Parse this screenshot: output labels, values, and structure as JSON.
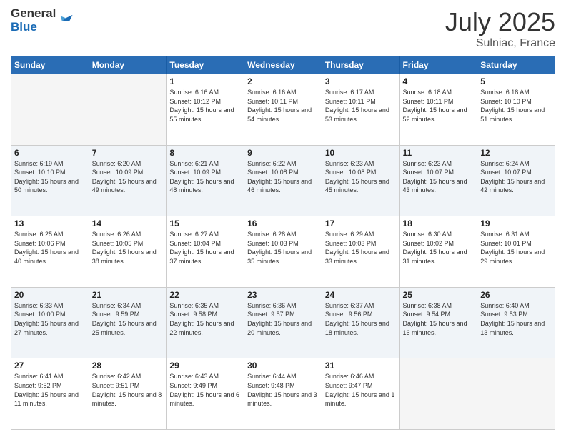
{
  "logo": {
    "general": "General",
    "blue": "Blue"
  },
  "title": {
    "month": "July 2025",
    "location": "Sulniac, France"
  },
  "weekdays": [
    "Sunday",
    "Monday",
    "Tuesday",
    "Wednesday",
    "Thursday",
    "Friday",
    "Saturday"
  ],
  "weeks": [
    [
      {
        "day": "",
        "sunrise": "",
        "sunset": "",
        "daylight": ""
      },
      {
        "day": "",
        "sunrise": "",
        "sunset": "",
        "daylight": ""
      },
      {
        "day": "1",
        "sunrise": "Sunrise: 6:16 AM",
        "sunset": "Sunset: 10:12 PM",
        "daylight": "Daylight: 15 hours and 55 minutes."
      },
      {
        "day": "2",
        "sunrise": "Sunrise: 6:16 AM",
        "sunset": "Sunset: 10:11 PM",
        "daylight": "Daylight: 15 hours and 54 minutes."
      },
      {
        "day": "3",
        "sunrise": "Sunrise: 6:17 AM",
        "sunset": "Sunset: 10:11 PM",
        "daylight": "Daylight: 15 hours and 53 minutes."
      },
      {
        "day": "4",
        "sunrise": "Sunrise: 6:18 AM",
        "sunset": "Sunset: 10:11 PM",
        "daylight": "Daylight: 15 hours and 52 minutes."
      },
      {
        "day": "5",
        "sunrise": "Sunrise: 6:18 AM",
        "sunset": "Sunset: 10:10 PM",
        "daylight": "Daylight: 15 hours and 51 minutes."
      }
    ],
    [
      {
        "day": "6",
        "sunrise": "Sunrise: 6:19 AM",
        "sunset": "Sunset: 10:10 PM",
        "daylight": "Daylight: 15 hours and 50 minutes."
      },
      {
        "day": "7",
        "sunrise": "Sunrise: 6:20 AM",
        "sunset": "Sunset: 10:09 PM",
        "daylight": "Daylight: 15 hours and 49 minutes."
      },
      {
        "day": "8",
        "sunrise": "Sunrise: 6:21 AM",
        "sunset": "Sunset: 10:09 PM",
        "daylight": "Daylight: 15 hours and 48 minutes."
      },
      {
        "day": "9",
        "sunrise": "Sunrise: 6:22 AM",
        "sunset": "Sunset: 10:08 PM",
        "daylight": "Daylight: 15 hours and 46 minutes."
      },
      {
        "day": "10",
        "sunrise": "Sunrise: 6:23 AM",
        "sunset": "Sunset: 10:08 PM",
        "daylight": "Daylight: 15 hours and 45 minutes."
      },
      {
        "day": "11",
        "sunrise": "Sunrise: 6:23 AM",
        "sunset": "Sunset: 10:07 PM",
        "daylight": "Daylight: 15 hours and 43 minutes."
      },
      {
        "day": "12",
        "sunrise": "Sunrise: 6:24 AM",
        "sunset": "Sunset: 10:07 PM",
        "daylight": "Daylight: 15 hours and 42 minutes."
      }
    ],
    [
      {
        "day": "13",
        "sunrise": "Sunrise: 6:25 AM",
        "sunset": "Sunset: 10:06 PM",
        "daylight": "Daylight: 15 hours and 40 minutes."
      },
      {
        "day": "14",
        "sunrise": "Sunrise: 6:26 AM",
        "sunset": "Sunset: 10:05 PM",
        "daylight": "Daylight: 15 hours and 38 minutes."
      },
      {
        "day": "15",
        "sunrise": "Sunrise: 6:27 AM",
        "sunset": "Sunset: 10:04 PM",
        "daylight": "Daylight: 15 hours and 37 minutes."
      },
      {
        "day": "16",
        "sunrise": "Sunrise: 6:28 AM",
        "sunset": "Sunset: 10:03 PM",
        "daylight": "Daylight: 15 hours and 35 minutes."
      },
      {
        "day": "17",
        "sunrise": "Sunrise: 6:29 AM",
        "sunset": "Sunset: 10:03 PM",
        "daylight": "Daylight: 15 hours and 33 minutes."
      },
      {
        "day": "18",
        "sunrise": "Sunrise: 6:30 AM",
        "sunset": "Sunset: 10:02 PM",
        "daylight": "Daylight: 15 hours and 31 minutes."
      },
      {
        "day": "19",
        "sunrise": "Sunrise: 6:31 AM",
        "sunset": "Sunset: 10:01 PM",
        "daylight": "Daylight: 15 hours and 29 minutes."
      }
    ],
    [
      {
        "day": "20",
        "sunrise": "Sunrise: 6:33 AM",
        "sunset": "Sunset: 10:00 PM",
        "daylight": "Daylight: 15 hours and 27 minutes."
      },
      {
        "day": "21",
        "sunrise": "Sunrise: 6:34 AM",
        "sunset": "Sunset: 9:59 PM",
        "daylight": "Daylight: 15 hours and 25 minutes."
      },
      {
        "day": "22",
        "sunrise": "Sunrise: 6:35 AM",
        "sunset": "Sunset: 9:58 PM",
        "daylight": "Daylight: 15 hours and 22 minutes."
      },
      {
        "day": "23",
        "sunrise": "Sunrise: 6:36 AM",
        "sunset": "Sunset: 9:57 PM",
        "daylight": "Daylight: 15 hours and 20 minutes."
      },
      {
        "day": "24",
        "sunrise": "Sunrise: 6:37 AM",
        "sunset": "Sunset: 9:56 PM",
        "daylight": "Daylight: 15 hours and 18 minutes."
      },
      {
        "day": "25",
        "sunrise": "Sunrise: 6:38 AM",
        "sunset": "Sunset: 9:54 PM",
        "daylight": "Daylight: 15 hours and 16 minutes."
      },
      {
        "day": "26",
        "sunrise": "Sunrise: 6:40 AM",
        "sunset": "Sunset: 9:53 PM",
        "daylight": "Daylight: 15 hours and 13 minutes."
      }
    ],
    [
      {
        "day": "27",
        "sunrise": "Sunrise: 6:41 AM",
        "sunset": "Sunset: 9:52 PM",
        "daylight": "Daylight: 15 hours and 11 minutes."
      },
      {
        "day": "28",
        "sunrise": "Sunrise: 6:42 AM",
        "sunset": "Sunset: 9:51 PM",
        "daylight": "Daylight: 15 hours and 8 minutes."
      },
      {
        "day": "29",
        "sunrise": "Sunrise: 6:43 AM",
        "sunset": "Sunset: 9:49 PM",
        "daylight": "Daylight: 15 hours and 6 minutes."
      },
      {
        "day": "30",
        "sunrise": "Sunrise: 6:44 AM",
        "sunset": "Sunset: 9:48 PM",
        "daylight": "Daylight: 15 hours and 3 minutes."
      },
      {
        "day": "31",
        "sunrise": "Sunrise: 6:46 AM",
        "sunset": "Sunset: 9:47 PM",
        "daylight": "Daylight: 15 hours and 1 minute."
      },
      {
        "day": "",
        "sunrise": "",
        "sunset": "",
        "daylight": ""
      },
      {
        "day": "",
        "sunrise": "",
        "sunset": "",
        "daylight": ""
      }
    ]
  ]
}
